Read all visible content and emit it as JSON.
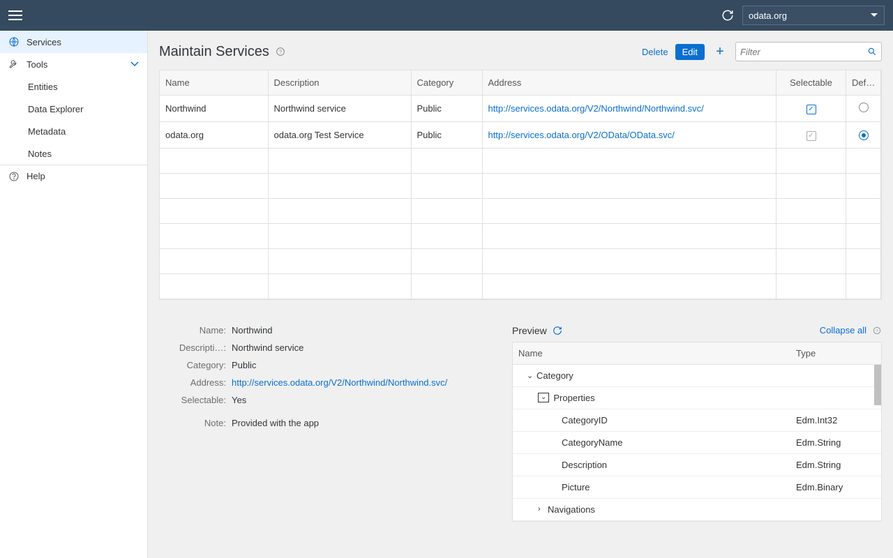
{
  "colors": {
    "accent": "#0a6ed1",
    "topbar": "#354a5f"
  },
  "topbar": {
    "service_selected": "odata.org"
  },
  "sidebar": {
    "items": [
      {
        "label": "Services"
      },
      {
        "label": "Tools"
      },
      {
        "label": "Entities"
      },
      {
        "label": "Data Explorer"
      },
      {
        "label": "Metadata"
      },
      {
        "label": "Notes"
      },
      {
        "label": "Help"
      }
    ]
  },
  "page": {
    "title": "Maintain Services",
    "delete_label": "Delete",
    "edit_label": "Edit",
    "filter_placeholder": "Filter"
  },
  "table": {
    "headers": {
      "name": "Name",
      "description": "Description",
      "category": "Category",
      "address": "Address",
      "selectable": "Selectable",
      "default": "Def…"
    },
    "rows": [
      {
        "name": "Northwind",
        "description": "Northwind service",
        "category": "Public",
        "address": "http://services.odata.org/V2/Northwind/Northwind.svc/",
        "selectable": true,
        "selectable_enabled": true,
        "default": false
      },
      {
        "name": "odata.org",
        "description": "odata.org Test Service",
        "category": "Public",
        "address": "http://services.odata.org/V2/OData/OData.svc/",
        "selectable": true,
        "selectable_enabled": false,
        "default": true
      }
    ]
  },
  "details": {
    "labels": {
      "name": "Name:",
      "description": "Descripti…:",
      "category": "Category:",
      "address": "Address:",
      "selectable": "Selectable:",
      "note": "Note:"
    },
    "values": {
      "name": "Northwind",
      "description": "Northwind service",
      "category": "Public",
      "address": "http://services.odata.org/V2/Northwind/Northwind.svc/",
      "selectable": "Yes",
      "note": "Provided with the app"
    }
  },
  "preview": {
    "title": "Preview",
    "collapse_all": "Collapse all",
    "headers": {
      "name": "Name",
      "type": "Type"
    },
    "rows": [
      {
        "level": 1,
        "name": "Category",
        "type": "",
        "icon": "down"
      },
      {
        "level": 2,
        "name": "Properties",
        "type": "",
        "icon": "box-down"
      },
      {
        "level": 3,
        "name": "CategoryID",
        "type": "Edm.Int32"
      },
      {
        "level": 3,
        "name": "CategoryName",
        "type": "Edm.String"
      },
      {
        "level": 3,
        "name": "Description",
        "type": "Edm.String"
      },
      {
        "level": 3,
        "name": "Picture",
        "type": "Edm.Binary"
      },
      {
        "level": 2,
        "name": "Navigations",
        "type": "",
        "icon": "right"
      }
    ]
  }
}
